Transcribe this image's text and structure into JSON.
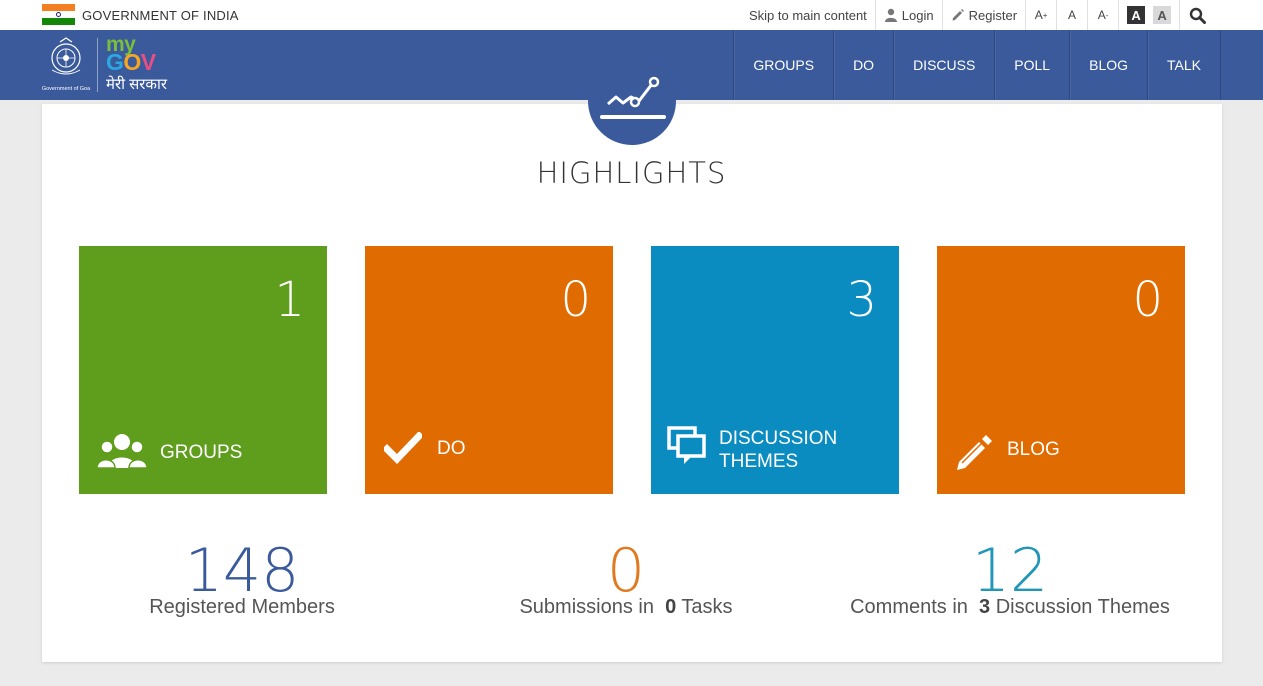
{
  "topbar": {
    "government_label": "GOVERNMENT OF INDIA",
    "skip_label": "Skip to main content",
    "login_label": "Login",
    "register_label": "Register",
    "font_increase": "A",
    "font_increase_sup": "+",
    "font_normal": "A",
    "font_decrease": "A",
    "font_decrease_sup": "-",
    "contrast_dark": "A",
    "contrast_light": "A"
  },
  "header": {
    "emblem_caption": "Government of Goa",
    "logo_my": "my",
    "logo_gov": [
      "G",
      "O",
      "V"
    ],
    "logo_hindi": "मेरी सरकार",
    "menu": [
      "GROUPS",
      "DO",
      "DISCUSS",
      "POLL",
      "BLOG",
      "TALK"
    ]
  },
  "main": {
    "title": "HIGHLIGHTS",
    "tiles": [
      {
        "label": "GROUPS",
        "count": "1",
        "icon": "users-icon",
        "color": "#5f9e1d"
      },
      {
        "label": "DO",
        "count": "0",
        "icon": "checkmark-icon",
        "color": "#e06b00"
      },
      {
        "label_line1": "DISCUSSION",
        "label_line2": "THEMES",
        "count": "3",
        "icon": "chat-bubbles-icon",
        "color": "#0a8cc0"
      },
      {
        "label": "BLOG",
        "count": "0",
        "icon": "pencil-icon",
        "color": "#e06b00"
      }
    ],
    "stats": [
      {
        "value": "148",
        "text": "Registered Members",
        "color": "#3a5a9b"
      },
      {
        "value": "0",
        "prefix": "Submissions in",
        "bold": "0",
        "suffix": "Tasks",
        "color": "#e07a1f"
      },
      {
        "value": "12",
        "prefix": "Comments in",
        "bold": "3",
        "suffix": "Discussion Themes",
        "color": "#2196b8"
      }
    ]
  }
}
